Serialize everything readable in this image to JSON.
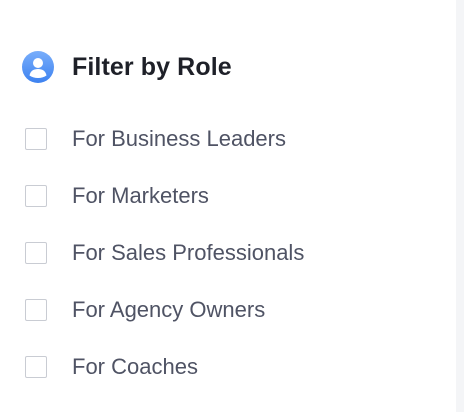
{
  "filter": {
    "title": "Filter by Role",
    "icon": "user-circle-icon",
    "accent_color": "#3d82f0",
    "options": [
      {
        "label": "For Business Leaders",
        "checked": false
      },
      {
        "label": "For Marketers",
        "checked": false
      },
      {
        "label": "For Sales Professionals",
        "checked": false
      },
      {
        "label": "For Agency Owners",
        "checked": false
      },
      {
        "label": "For Coaches",
        "checked": false
      }
    ]
  }
}
